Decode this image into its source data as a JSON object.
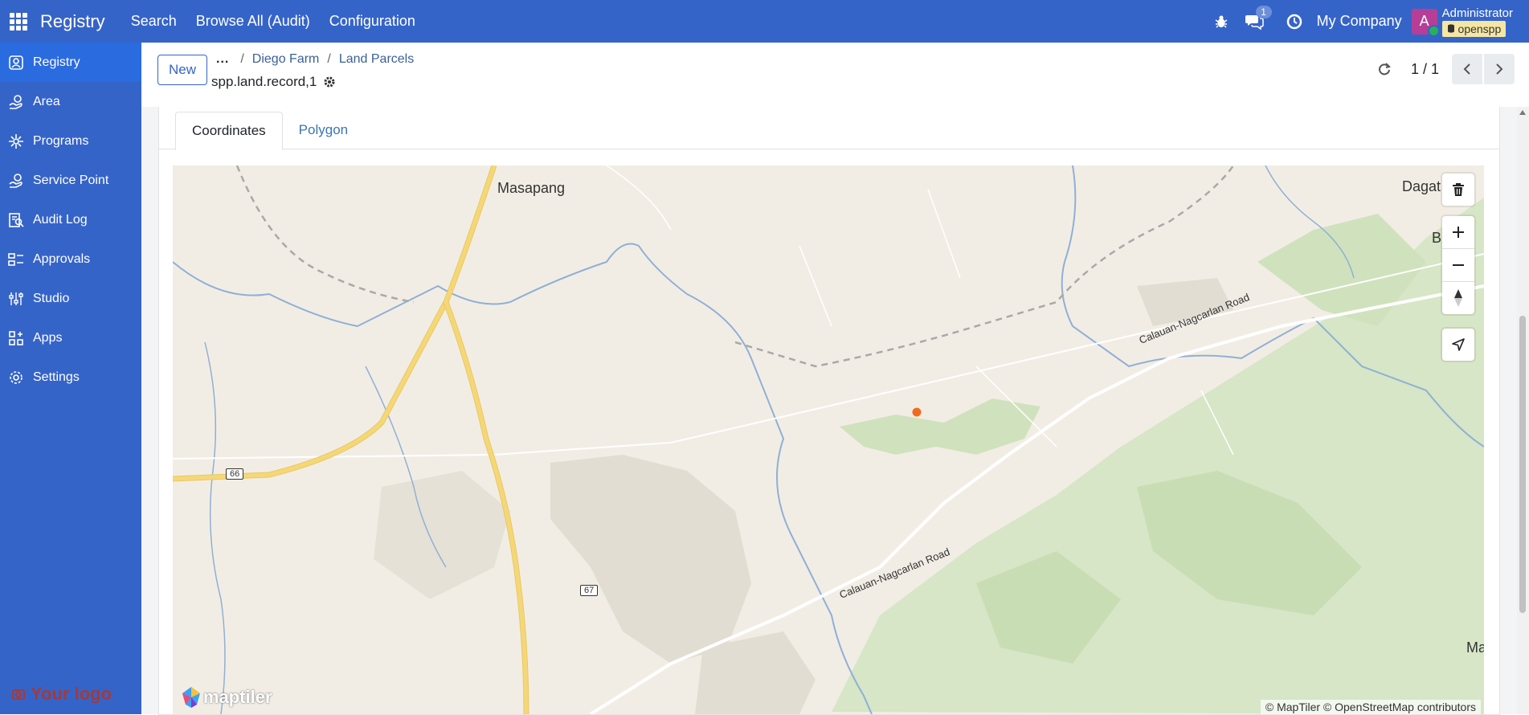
{
  "navbar": {
    "app_name": "Registry",
    "menus": [
      "Search",
      "Browse All (Audit)",
      "Configuration"
    ],
    "messages_badge": "1",
    "company": "My Company",
    "avatar_letter": "A",
    "user": "Administrator",
    "database": "openspp"
  },
  "sidebar": {
    "items": [
      {
        "label": "Registry",
        "icon": "registry-icon"
      },
      {
        "label": "Area",
        "icon": "area-icon"
      },
      {
        "label": "Programs",
        "icon": "programs-icon"
      },
      {
        "label": "Service Point",
        "icon": "service-point-icon"
      },
      {
        "label": "Audit Log",
        "icon": "audit-log-icon"
      },
      {
        "label": "Approvals",
        "icon": "approvals-icon"
      },
      {
        "label": "Studio",
        "icon": "studio-icon"
      },
      {
        "label": "Apps",
        "icon": "apps-icon"
      },
      {
        "label": "Settings",
        "icon": "settings-icon"
      }
    ],
    "logo_text": "Your logo"
  },
  "control": {
    "new_label": "New",
    "ellipsis": "...",
    "breadcrumb": [
      "Diego Farm",
      "Land Parcels"
    ],
    "record_name": "spp.land.record,1",
    "pager": "1 / 1"
  },
  "tabs": [
    "Coordinates",
    "Polygon"
  ],
  "map": {
    "labels": [
      "Masapang",
      "Dagat",
      "B",
      "Ma"
    ],
    "road_labels": [
      "Calauan-Nagcarlan Road",
      "Calauan-Nagcarlan Road"
    ],
    "road_shields": [
      "66",
      "67"
    ],
    "attribution": "© MapTiler © OpenStreetMap contributors",
    "brand": "maptiler",
    "colors": {
      "land": "#f2ede4",
      "forest": "#cfe2bd",
      "water": "#8fb0d6",
      "road": "#f5d776",
      "marker": "#f26b1d"
    }
  },
  "colors": {
    "navbar": "#3564c9",
    "accent": "#2b6be0"
  }
}
